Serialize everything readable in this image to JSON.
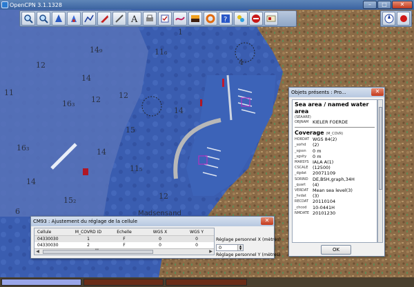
{
  "window": {
    "title": "OpenCPN 3.1.1328"
  },
  "depths": [
    "14₉",
    "11₆",
    "12",
    "14",
    "12",
    "16₃",
    "15",
    "16₃",
    "14",
    "14",
    "15₂",
    "11₅",
    "12",
    "14",
    "1",
    "11",
    "12",
    "4",
    "6"
  ],
  "map_labels": {
    "town": "Madsensand",
    "symbol_4": "4"
  },
  "objects_dialog": {
    "title": "Objets présents : Pro...",
    "heading": "Sea area / named water area",
    "class_code": "(SEAARE)",
    "objnam_label": "OBJNAM",
    "objnam_value": "KIELER FOERDE",
    "coverage_heading": "Coverage",
    "coverage_code": "(M_COVR)",
    "attributes": [
      {
        "k": "HORDAT",
        "v": "WGS 84(2)"
      },
      {
        "k": "_sorhd",
        "v": "(2)"
      },
      {
        "k": "_sgssn",
        "v": "0 m"
      },
      {
        "k": "_sgsity",
        "v": "0 m"
      },
      {
        "k": "MARSYS",
        "v": "IALA A(1)"
      },
      {
        "k": "CSCALE",
        "v": "(12500)"
      },
      {
        "k": "_dgdat",
        "v": "20071109"
      },
      {
        "k": "SORIND",
        "v": "DE,BSH,graph,34H"
      },
      {
        "k": "_quart",
        "v": "(4)"
      },
      {
        "k": "VERDAT",
        "v": "Mean sea level(3)"
      },
      {
        "k": "_hvdat",
        "v": "(3)"
      },
      {
        "k": "RECDAT",
        "v": "20110104"
      },
      {
        "k": "_chcod",
        "v": "10-0441H"
      },
      {
        "k": "NMDATE",
        "v": "20101230"
      }
    ],
    "ok_label": "OK"
  },
  "cell_dialog": {
    "title": "CM93 : Ajustement du réglage de la cellule",
    "columns": [
      "Cellule",
      "M_COVRD ID",
      "Echelle",
      "WGS X",
      "WGS Y"
    ],
    "rows": [
      [
        "04330030",
        "1",
        "F",
        "0",
        "0"
      ],
      [
        "04330030",
        "2",
        "F",
        "0",
        "0"
      ]
    ],
    "label_x": "Réglage personnel X (mètres)",
    "value_x": "0",
    "label_y": "Réglage personnel Y (mètres)",
    "scroll_marker": "'''"
  },
  "colors": {
    "land": "#8a6a45",
    "deep_water": "#3355a8",
    "shallow_water": "#2a4ca0",
    "toolbar": "#a8bad3",
    "status_1": "#9aa6e8",
    "status_2": "#6a2d18"
  },
  "icons": [
    "zoom-in-icon",
    "zoom-out-icon",
    "ship-center-icon",
    "track-icon",
    "route-icon",
    "mark-icon",
    "measure-icon",
    "text-icon",
    "print-icon",
    "settings-icon",
    "tide-icon",
    "color-icon",
    "mob-icon",
    "help-icon",
    "layers-icon",
    "stop-icon",
    "about-icon",
    "compass-icon"
  ]
}
